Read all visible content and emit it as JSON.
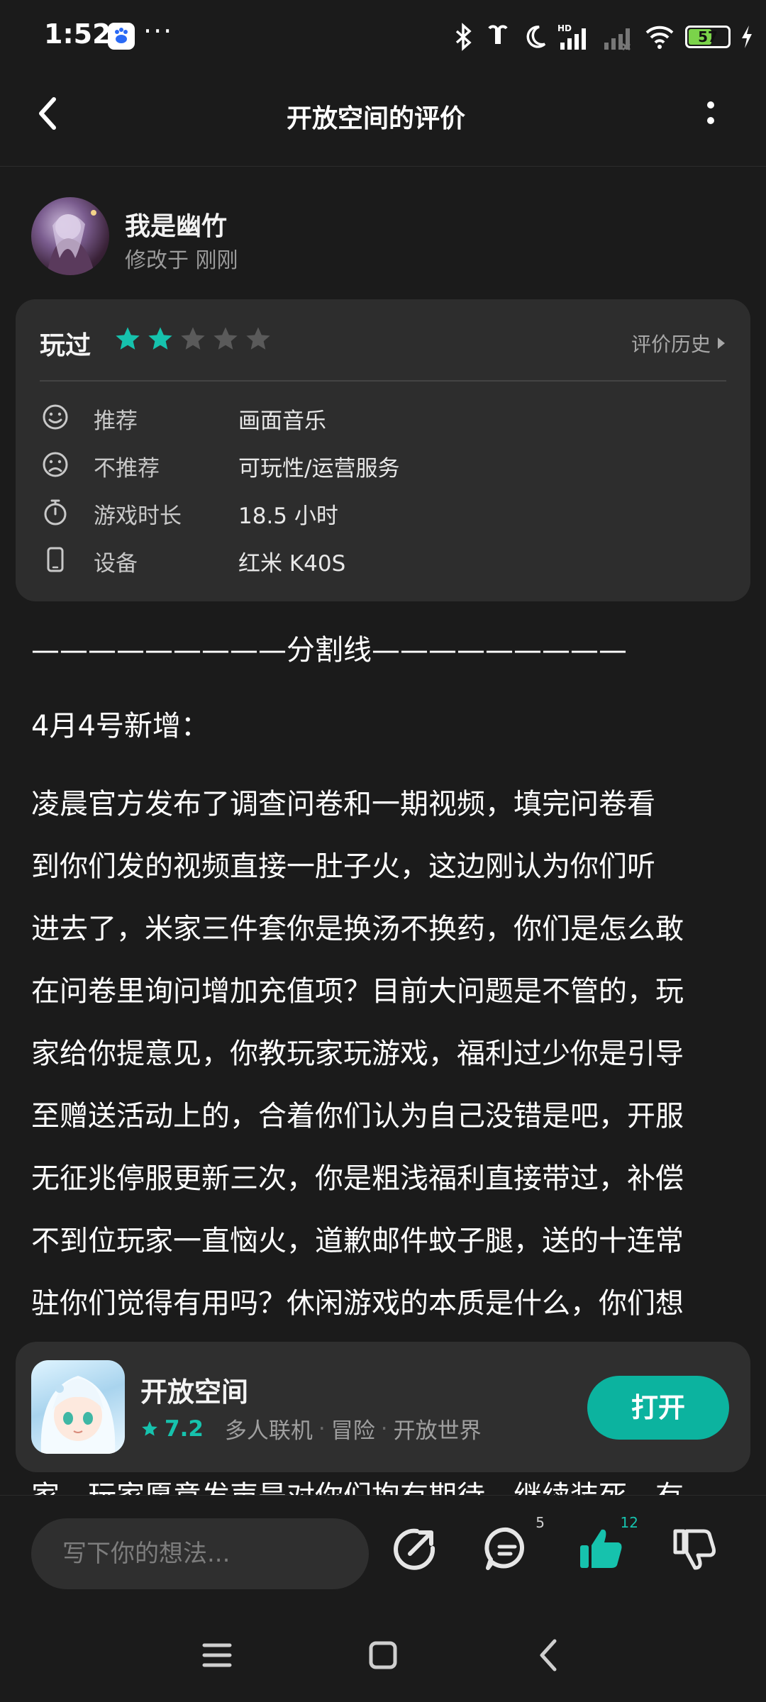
{
  "status_bar": {
    "time": "1:52",
    "more": "···",
    "battery": "57"
  },
  "nav": {
    "title": "开放空间的评价"
  },
  "author": {
    "name": "我是幽竹",
    "meta": "修改于 刚刚"
  },
  "review": {
    "status_label": "玩过",
    "rating": 2,
    "max_rating": 5,
    "history_label": "评价历史",
    "rows": [
      {
        "key": "推荐",
        "value": "画面音乐",
        "icon": "smile-icon"
      },
      {
        "key": "不推荐",
        "value": "可玩性/运营服务",
        "icon": "frown-icon"
      },
      {
        "key": "游戏时长",
        "value": "18.5 小时",
        "icon": "stopwatch-icon"
      },
      {
        "key": "设备",
        "value": "红米 K40S",
        "icon": "phone-icon"
      }
    ]
  },
  "content": {
    "divider": "—————————分割线—————————",
    "heading": "4月4号新增：",
    "lines": [
      "凌晨官方发布了调查问卷和一期视频，填完问卷看",
      "到你们发的视频直接一肚子火，这边刚认为你们听",
      "进去了，米家三件套你是换汤不换药，你们是怎么敢",
      "在问卷里询问增加充值项？目前大问题是不管的，玩",
      "家给你提意见，你教玩家玩游戏，福利过少你是引导",
      "至赠送活动上的，合着你们认为自己没错是吧，开服",
      "无征兆停服更新三次，你是粗浅福利直接带过，补偿",
      "不到位玩家一直恼火，道歉邮件蚊子腿，送的十连常",
      "驻你们觉得有用吗？休闲游戏的本质是什么，你们想"
    ],
    "cut_line": "家，玩家愿意发声是对你们抱有期待，继续装死，有"
  },
  "game": {
    "name": "开放空间",
    "score": "7.2",
    "tags": [
      "多人联机",
      "冒险",
      "开放世界"
    ],
    "open_label": "打开"
  },
  "action_bar": {
    "input_placeholder": "写下你的想法...",
    "comment_count": "5",
    "like_count": "12",
    "accent": "#16c2ad"
  }
}
